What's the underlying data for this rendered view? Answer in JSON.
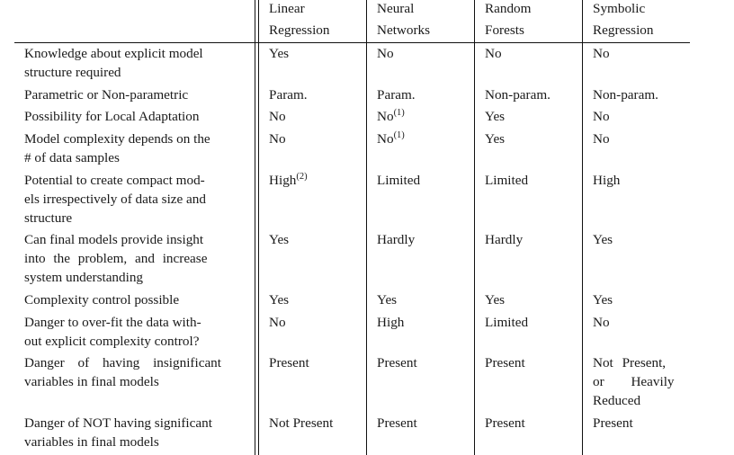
{
  "table": {
    "headers": [
      {
        "line1": "Linear",
        "line2": "Regression"
      },
      {
        "line1": "Neural",
        "line2": "Networks"
      },
      {
        "line1": "Random",
        "line2": "Forests"
      },
      {
        "line1": "Symbolic",
        "line2": "Regression"
      }
    ],
    "rows": [
      {
        "criterion": "Knowledge about explicit model structure required",
        "values": [
          "Yes",
          "No",
          "No",
          "No"
        ],
        "notes": [
          "",
          "",
          "",
          ""
        ]
      },
      {
        "criterion": "Parametric or Non-parametric",
        "values": [
          "Param.",
          "Param.",
          "Non-param.",
          "Non-param."
        ],
        "notes": [
          "",
          "",
          "",
          ""
        ]
      },
      {
        "criterion": "Possibility for Local Adaptation",
        "values": [
          "No",
          "No",
          "Yes",
          "No"
        ],
        "notes": [
          "",
          "(1)",
          "",
          ""
        ]
      },
      {
        "criterion": "Model complexity depends on the # of data samples",
        "values": [
          "No",
          "No",
          "Yes",
          "No"
        ],
        "notes": [
          "",
          "(1)",
          "",
          ""
        ]
      },
      {
        "criterion": "Potential to create compact models irrespectively of data size and structure",
        "values": [
          "High",
          "Limited",
          "Limited",
          "High"
        ],
        "notes": [
          "(2)",
          "",
          "",
          ""
        ]
      },
      {
        "criterion": "Can final models provide insight into the problem, and increase system understanding",
        "values": [
          "Yes",
          "Hardly",
          "Hardly",
          "Yes"
        ],
        "notes": [
          "",
          "",
          "",
          ""
        ]
      },
      {
        "criterion": "Complexity control possible",
        "values": [
          "Yes",
          "Yes",
          "Yes",
          "Yes"
        ],
        "notes": [
          "",
          "",
          "",
          ""
        ]
      },
      {
        "criterion": "Danger to over-fit the data without explicit complexity control?",
        "values": [
          "No",
          "High",
          "Limited",
          "No"
        ],
        "notes": [
          "",
          "",
          "",
          ""
        ]
      },
      {
        "criterion": "Danger of having insignificant variables in final models",
        "values": [
          "Present",
          "Present",
          "Present",
          "Not Present, or Heavily Reduced"
        ],
        "notes": [
          "",
          "",
          "",
          ""
        ]
      },
      {
        "criterion": "Danger of NOT having significant variables in final models",
        "values": [
          "Not Present",
          "Present",
          "Present",
          "Present"
        ],
        "notes": [
          "",
          "",
          "",
          ""
        ]
      }
    ]
  },
  "display_lines": {
    "r0": [
      "Knowledge about explicit model",
      "structure required"
    ],
    "r3": [
      "Model complexity depends on the",
      "# of data samples"
    ],
    "r4": [
      "Potential to create compact mod-",
      "els irrespectively of data size and",
      "structure"
    ],
    "r5": [
      "Can final models provide insight",
      "into the problem, and increase",
      "system understanding"
    ],
    "r7": [
      "Danger to over-fit the data with-",
      "out explicit complexity control?"
    ],
    "r8": [
      "Danger of having insignificant",
      "variables in final models"
    ],
    "r8c4": [
      "Not Present,",
      "or Heavily",
      "Reduced"
    ],
    "r9": [
      "Danger of NOT having significant",
      "variables in final models"
    ]
  }
}
